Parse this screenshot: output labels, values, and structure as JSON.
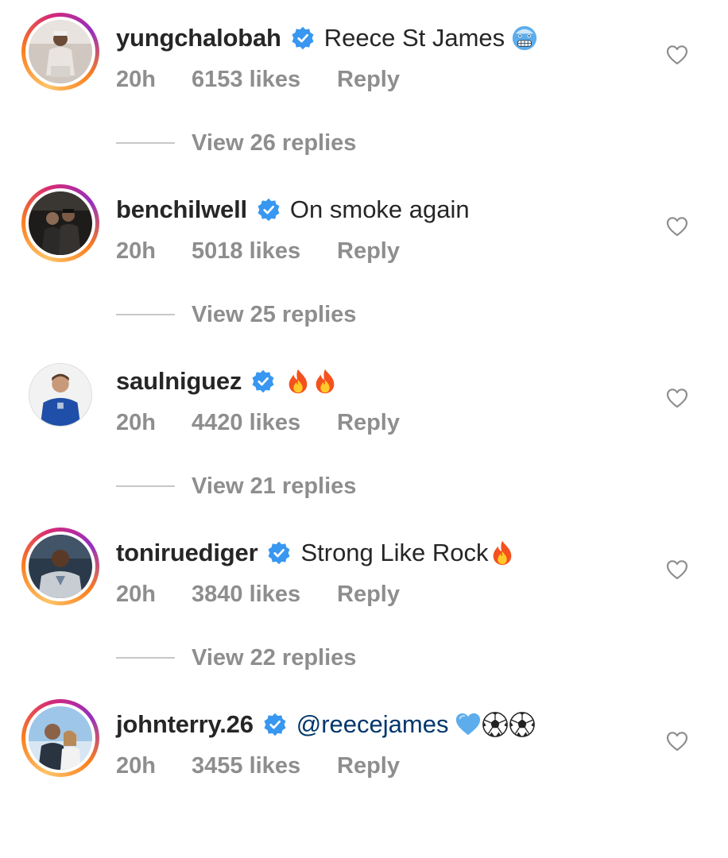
{
  "comments": [
    {
      "username": "yungchalobah",
      "text": "Reece St James",
      "emojis": [
        "cold-face-emoji"
      ],
      "time": "20h",
      "likes": "6153 likes",
      "reply": "Reply",
      "view_replies": "View 26 replies"
    },
    {
      "username": "benchilwell",
      "text": "On smoke again",
      "emojis": [],
      "time": "20h",
      "likes": "5018 likes",
      "reply": "Reply",
      "view_replies": "View 25 replies"
    },
    {
      "username": "saulniguez",
      "text": "",
      "emojis": [
        "fire-emoji",
        "fire-emoji"
      ],
      "time": "20h",
      "likes": "4420 likes",
      "reply": "Reply",
      "view_replies": "View 21 replies"
    },
    {
      "username": "toniruediger",
      "text": "Strong Like Rock",
      "emojis": [
        "fire-emoji"
      ],
      "time": "20h",
      "likes": "3840 likes",
      "reply": "Reply",
      "view_replies": "View 22 replies"
    },
    {
      "username": "johnterry.26",
      "text": "@reecejames",
      "emojis": [
        "blue-heart-emoji",
        "soccer-ball-emoji",
        "soccer-ball-emoji"
      ],
      "time": "20h",
      "likes": "3455 likes",
      "reply": "Reply"
    }
  ],
  "colors": {
    "username": "#262626",
    "meta": "#8e8e8e",
    "mention": "#00376b",
    "verified": "#3897f0"
  }
}
